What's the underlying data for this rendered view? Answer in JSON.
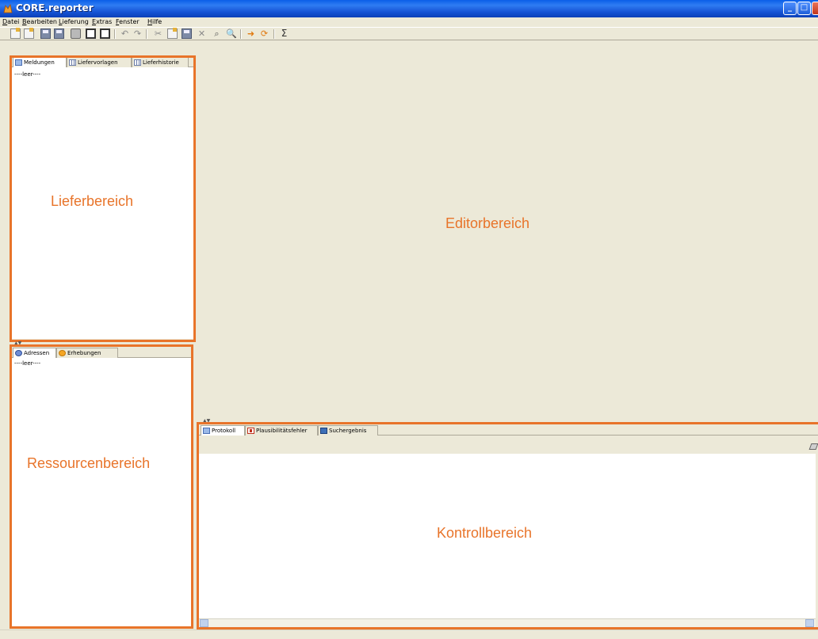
{
  "window": {
    "title": "CORE.reporter",
    "min_glyph": "_",
    "max_glyph": "□",
    "close_glyph": "×"
  },
  "menu": [
    "Datei",
    "Bearbeiten",
    "Lieferung",
    "Extras",
    "Fenster",
    "Hilfe"
  ],
  "toolbar": {
    "undo_glyph": "↶",
    "redo_glyph": "↷",
    "cut_glyph": "✂",
    "delete_glyph": "✕",
    "find_glyph": "⌕",
    "zoom_glyph": "🔍",
    "sigma_glyph": "Σ"
  },
  "lieferbereich": {
    "tabs": [
      "Meldungen",
      "Liefervorlagen",
      "Lieferhistorie"
    ],
    "empty_text": "----leer----",
    "area_label": "Lieferbereich"
  },
  "ressourcenbereich": {
    "tabs": [
      "Adressen",
      "Erhebungen"
    ],
    "empty_text": "----leer----",
    "area_label": "Ressourcenbereich"
  },
  "editorbereich": {
    "area_label": "Editorbereich"
  },
  "kontrollbereich": {
    "tabs": [
      "Protokoll",
      "Plausibilitätsfehler",
      "Suchergebnis"
    ],
    "area_label": "Kontrollbereich"
  },
  "colors": {
    "annotation": "#e8742a",
    "titlebar": "#0a5ee8",
    "window_bg": "#ece9d8"
  }
}
